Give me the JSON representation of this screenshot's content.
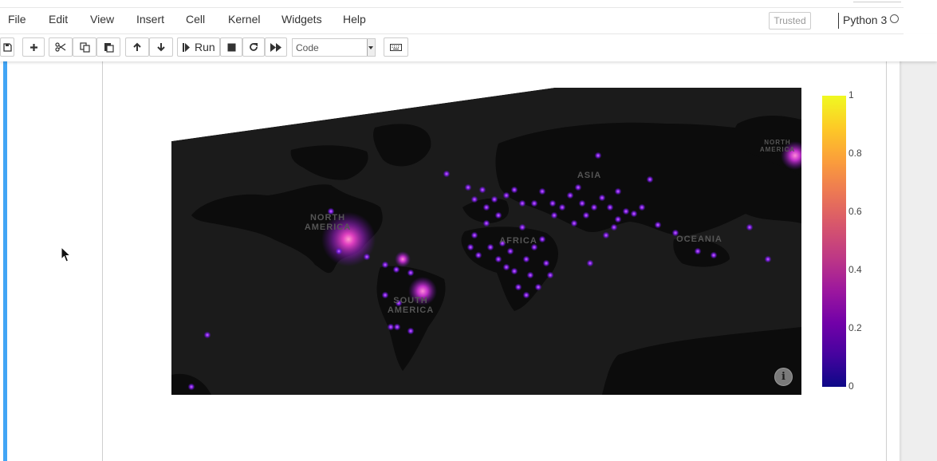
{
  "menubar": {
    "items": [
      "File",
      "Edit",
      "View",
      "Insert",
      "Cell",
      "Kernel",
      "Widgets",
      "Help"
    ],
    "trusted_label": "Trusted",
    "kernel_name": "Python 3"
  },
  "toolbar": {
    "icons": [
      "save-icon",
      "plus-icon",
      "scissors-icon",
      "copy-icon",
      "paste-icon",
      "arrow-up-icon",
      "arrow-down-icon"
    ],
    "run_label": "Run",
    "cell_type": "Code"
  },
  "map": {
    "labels": [
      "NORTH AMERICA",
      "SOUTH AMERICA",
      "AFRICA",
      "ASIA",
      "OCEANIA",
      "NORTH AMERICA"
    ],
    "background_color": "#191919",
    "land_color": "#0b0b0b"
  },
  "colorbar": {
    "ticks": [
      "1",
      "0.8",
      "0.6",
      "0.4",
      "0.2",
      "0"
    ],
    "colors": [
      "#0d0887",
      "#7201a8",
      "#bd3786",
      "#ed7953",
      "#fdca26",
      "#f0f921"
    ]
  }
}
